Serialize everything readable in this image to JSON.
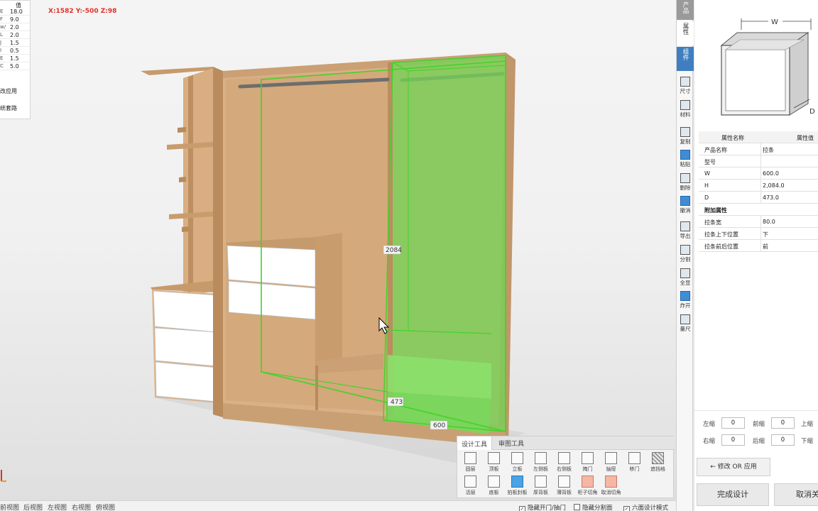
{
  "viewport": {
    "coords": "X:1582 Y:-500 Z:98",
    "dim_labels": {
      "height": "2084",
      "depth": "473",
      "width": "600"
    }
  },
  "param_table": {
    "header": "值",
    "rows": [
      {
        "k": "E",
        "v": "18.0"
      },
      {
        "k": "F",
        "v": "9.0"
      },
      {
        "k": "w/",
        "v": "2.0"
      },
      {
        "k": "L",
        "v": "2.0"
      },
      {
        "k": "J",
        "v": "1.5"
      },
      {
        "k": "I",
        "v": "0.5"
      },
      {
        "k": "E",
        "v": "1.5"
      },
      {
        "k": "C",
        "v": "5.0"
      }
    ],
    "apply_label": "改应用",
    "route_label": "统套路"
  },
  "view_bar": {
    "views": [
      "前视图",
      "后视图",
      "左视图",
      "右视图",
      "俯视图"
    ],
    "checks": [
      {
        "label": "隐藏开门/抽门",
        "checked": true
      },
      {
        "label": "隐藏分割面",
        "checked": false
      },
      {
        "label": "六面设计模式",
        "checked": true
      }
    ]
  },
  "tool_panel": {
    "tabs": [
      "设计工具",
      "审图工具"
    ],
    "row1": [
      {
        "label": "固层",
        "icon": "shelf-icon"
      },
      {
        "label": "顶板",
        "icon": "top-panel-icon"
      },
      {
        "label": "立板",
        "icon": "vertical-panel-icon"
      },
      {
        "label": "左侧板",
        "icon": "left-panel-icon"
      },
      {
        "label": "右侧板",
        "icon": "right-panel-icon"
      },
      {
        "label": "掩门",
        "icon": "door-icon"
      },
      {
        "label": "抽屉",
        "icon": "drawer-icon"
      },
      {
        "label": "移门",
        "icon": "sliding-door-icon"
      },
      {
        "label": "遮挡格",
        "icon": "grid-icon"
      }
    ],
    "row2": [
      {
        "label": "活层",
        "icon": "loose-shelf-icon"
      },
      {
        "label": "底板",
        "icon": "bottom-panel-icon"
      },
      {
        "label": "拍板封板",
        "icon": "seal-panel-icon"
      },
      {
        "label": "厚背板",
        "icon": "back-panel-icon"
      },
      {
        "label": "薄背板",
        "icon": "thin-back-icon"
      },
      {
        "label": "柜子切角",
        "icon": "corner-cut-icon"
      },
      {
        "label": "取消切角",
        "icon": "cancel-cut-icon"
      }
    ]
  },
  "sidebar": {
    "tabs": [
      "产品",
      "属性",
      "组件"
    ],
    "buttons": [
      {
        "label": "尺寸",
        "icon": "size-icon"
      },
      {
        "label": "材料",
        "icon": "material-icon"
      },
      {
        "label": "复制",
        "icon": "copy-icon"
      },
      {
        "label": "粘贴",
        "icon": "paste-icon"
      },
      {
        "label": "删除",
        "icon": "delete-icon"
      },
      {
        "label": "撤消",
        "icon": "undo-icon"
      },
      {
        "label": "导出",
        "icon": "export-icon"
      },
      {
        "label": "分割",
        "icon": "split-icon"
      },
      {
        "label": "全显",
        "icon": "show-all-icon"
      },
      {
        "label": "炸开",
        "icon": "explode-icon"
      },
      {
        "label": "量尺",
        "icon": "ruler-icon"
      }
    ]
  },
  "thumbnail": {
    "w_label": "W",
    "d_label": "D"
  },
  "props": {
    "header_name": "属性名称",
    "header_value": "属性值",
    "rows": [
      {
        "k": "产品名称",
        "v": "拉条"
      },
      {
        "k": "型号",
        "v": ""
      },
      {
        "k": "W",
        "v": "600.0"
      },
      {
        "k": "H",
        "v": "2,084.0"
      },
      {
        "k": "D",
        "v": "473.0"
      }
    ],
    "extra_title": "附加属性",
    "extra_rows": [
      {
        "k": "拉条宽",
        "v": "80.0"
      },
      {
        "k": "拉条上下位置",
        "v": "下"
      },
      {
        "k": "拉条前后位置",
        "v": "前"
      }
    ]
  },
  "offsets": {
    "left_shrink": "左缩",
    "left_val": "0",
    "front_shrink": "前缩",
    "front_val": "0",
    "top_shrink": "上缩",
    "right_shrink": "右缩",
    "right_val": "0",
    "back_shrink": "后缩",
    "back_val": "0",
    "bottom_shrink": "下缩"
  },
  "buttons": {
    "modify_apply": "← 修改 OR 应用",
    "finish": "完成设计",
    "cancel": "取消关"
  },
  "colors": {
    "wood": "#d4a97a",
    "wood_dark": "#b88a5c",
    "highlight": "#74d257",
    "tab_blue": "#3f7fc1",
    "accent_red": "#e0302a"
  }
}
